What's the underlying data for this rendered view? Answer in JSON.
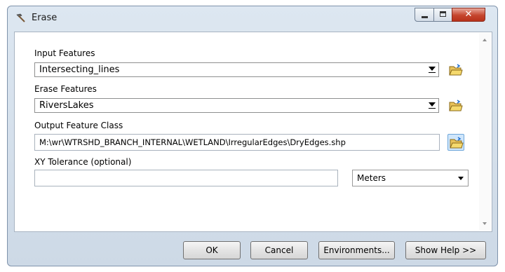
{
  "window": {
    "title": "Erase"
  },
  "form": {
    "input_features": {
      "label": "Input Features",
      "value": "Intersecting_lines"
    },
    "erase_features": {
      "label": "Erase Features",
      "value": "RiversLakes"
    },
    "output_feature_class": {
      "label": "Output Feature Class",
      "value": "M:\\wr\\WTRSHD_BRANCH_INTERNAL\\WETLAND\\IrregularEdges\\DryEdges.shp"
    },
    "xy_tolerance": {
      "label": "XY Tolerance (optional)",
      "value": "",
      "unit": "Meters"
    }
  },
  "buttons": {
    "ok": "OK",
    "cancel": "Cancel",
    "environments": "Environments...",
    "show_help": "Show Help >>"
  },
  "icons": {
    "title": "hammer-icon",
    "browse": "open-folder-icon"
  },
  "colors": {
    "close_button": "#c5452d",
    "selected_browse": "#cfe6fb"
  }
}
